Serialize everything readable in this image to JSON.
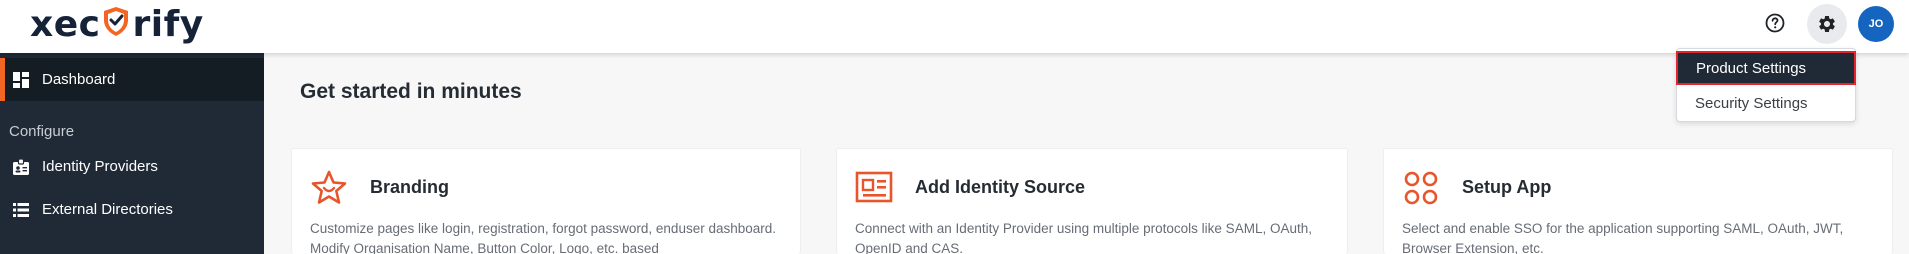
{
  "header": {
    "logo_left": "xec",
    "logo_right": "rify",
    "help_icon": "help-circle-icon",
    "settings_icon": "gear-icon",
    "avatar_initials": "JO",
    "colors": {
      "brand_orange": "#f26522",
      "brand_navy": "#152238",
      "avatar_bg": "#1565c0"
    }
  },
  "settings_menu": {
    "items": [
      {
        "label": "Product Settings",
        "selected": true
      },
      {
        "label": "Security Settings",
        "selected": false
      }
    ],
    "colors": {
      "selected_bg": "#1f2a36",
      "selected_border": "#e3262e"
    }
  },
  "sidebar": {
    "items": [
      {
        "label": "Dashboard",
        "icon": "dashboard-icon",
        "active": true
      }
    ],
    "section_label": "Configure",
    "configure_items": [
      {
        "label": "Identity Providers",
        "icon": "id-badge-icon"
      },
      {
        "label": "External Directories",
        "icon": "list-icon"
      }
    ],
    "colors": {
      "background": "#1f2a36",
      "active_bg": "#141c24",
      "active_accent": "#f26522"
    }
  },
  "main": {
    "title": "Get started in minutes",
    "cards": [
      {
        "title": "Branding",
        "icon": "star-face-icon",
        "description": "Customize pages like login, registration, forgot password, enduser dashboard. Modify Organisation Name, Button Color, Logo, etc. based"
      },
      {
        "title": "Add Identity Source",
        "icon": "id-card-icon",
        "description": "Connect with an Identity Provider using multiple protocols like SAML, OAuth, OpenID and CAS."
      },
      {
        "title": "Setup App",
        "icon": "apps-grid-icon",
        "description": "Select and enable SSO for the application supporting SAML, OAuth, JWT, Browser Extension, etc."
      }
    ],
    "colors": {
      "icon_orange": "#e8552a"
    }
  }
}
